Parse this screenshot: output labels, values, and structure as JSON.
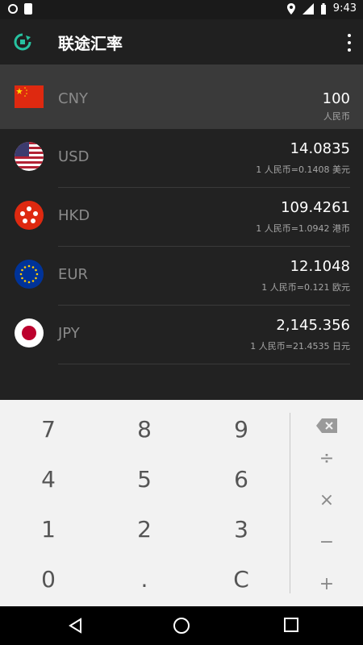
{
  "status": {
    "time": "9:43"
  },
  "app": {
    "title": "联途汇率"
  },
  "currencies": [
    {
      "code": "CNY",
      "value": "100",
      "sub": "人民币"
    },
    {
      "code": "USD",
      "value": "14.0835",
      "sub": "1 人民币=0.1408 美元"
    },
    {
      "code": "HKD",
      "value": "109.4261",
      "sub": "1 人民币=1.0942 港币"
    },
    {
      "code": "EUR",
      "value": "12.1048",
      "sub": "1 人民币=0.121 欧元"
    },
    {
      "code": "JPY",
      "value": "2,145.356",
      "sub": "1 人民币=21.4535 日元"
    }
  ],
  "keypad": {
    "k7": "7",
    "k8": "8",
    "k9": "9",
    "k4": "4",
    "k5": "5",
    "k6": "6",
    "k1": "1",
    "k2": "2",
    "k3": "3",
    "k0": "0",
    "kdot": ".",
    "kc": "C",
    "div": "÷",
    "mul": "×",
    "sub": "−",
    "add": "+"
  },
  "colors": {
    "accent": "#27c2a0",
    "bg": "#222222",
    "active": "#3a3a3a",
    "keypad": "#f2f2f2"
  }
}
